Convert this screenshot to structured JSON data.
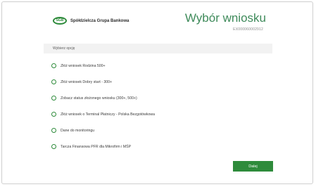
{
  "header": {
    "logo_mark": "SGB",
    "logo_text": "Spółdzielcza Grupa Bankowa",
    "title": "Wybór wniosku",
    "application_id": "EX000060002912"
  },
  "form": {
    "section_label": "Wybierz opcję",
    "options": [
      {
        "label": "Złóż wniosek Rodzina 500+"
      },
      {
        "label": "Złóż wniosek Dobry start - 300+"
      },
      {
        "label": "Zobacz status złożonego wniosku (300+, 500+)"
      },
      {
        "label": "Złóż wniosek o Terminal Płatniczy - Polska Bezgotówkowa"
      },
      {
        "label": "Dane do monitoringu"
      },
      {
        "label": "Tarcza Finansowa PFR dla Mikrofirm i MŚP"
      }
    ],
    "next_label": "Dalej"
  },
  "colors": {
    "accent": "#2e8b3b",
    "title": "#3e8a5a"
  }
}
